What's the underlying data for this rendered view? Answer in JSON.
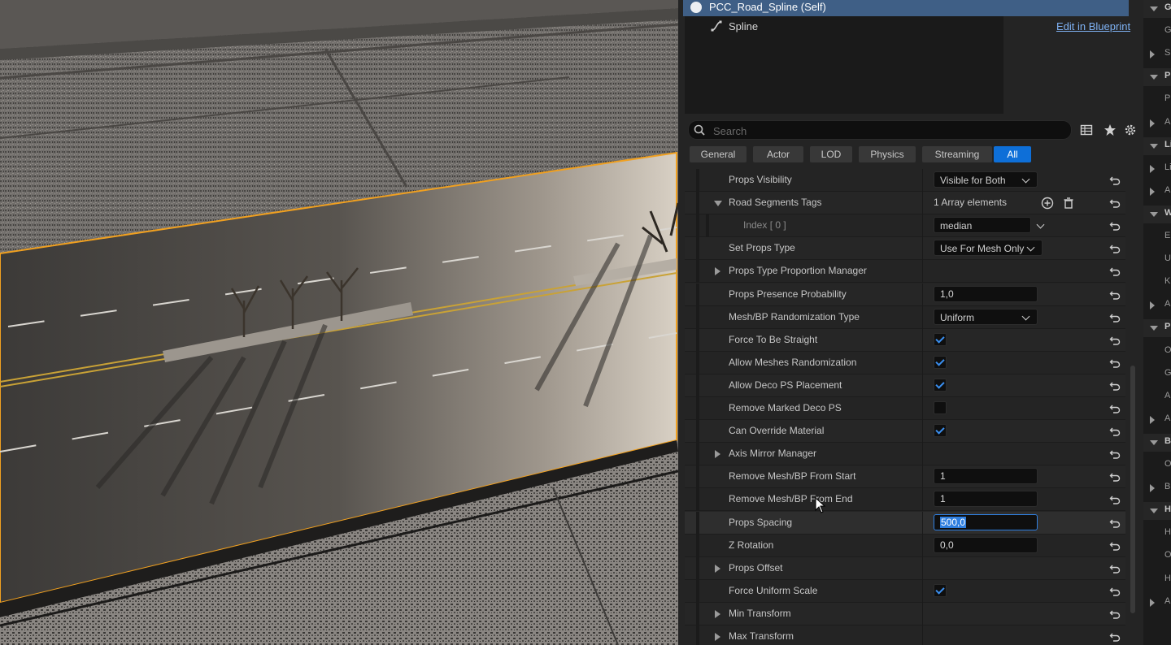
{
  "component_tree": {
    "self_label": "PCC_Road_Spline (Self)",
    "child_label": "Spline",
    "edit_link": "Edit in Blueprint"
  },
  "search": {
    "placeholder": "Search"
  },
  "filter_tabs": [
    "General",
    "Actor",
    "LOD",
    "Physics",
    "Streaming",
    "All"
  ],
  "active_tab": "All",
  "properties": [
    {
      "label": "Props Visibility",
      "type": "dropdown",
      "value": "Visible for Both"
    },
    {
      "label": "Road Segments Tags",
      "type": "array",
      "value": "1 Array elements",
      "expander": "down"
    },
    {
      "label": "Index [ 0 ]",
      "type": "dropdown",
      "value": "median",
      "nested": true
    },
    {
      "label": "Set Props Type",
      "type": "dropdown",
      "value": "Use For Mesh Only"
    },
    {
      "label": "Props Type Proportion Manager",
      "type": "group",
      "expander": "right"
    },
    {
      "label": "Props Presence Probability",
      "type": "number",
      "value": "1,0"
    },
    {
      "label": "Mesh/BP Randomization Type",
      "type": "dropdown",
      "value": "Uniform"
    },
    {
      "label": "Force To Be Straight",
      "type": "checkbox",
      "checked": true
    },
    {
      "label": "Allow Meshes Randomization",
      "type": "checkbox",
      "checked": true
    },
    {
      "label": "Allow Deco PS Placement",
      "type": "checkbox",
      "checked": true
    },
    {
      "label": "Remove Marked Deco PS",
      "type": "checkbox",
      "checked": false
    },
    {
      "label": "Can Override Material",
      "type": "checkbox",
      "checked": true
    },
    {
      "label": "Axis Mirror Manager",
      "type": "group",
      "expander": "right"
    },
    {
      "label": "Remove Mesh/BP From Start",
      "type": "number",
      "value": "1"
    },
    {
      "label": "Remove Mesh/BP From End",
      "type": "number",
      "value": "1"
    },
    {
      "label": "Props Spacing",
      "type": "number",
      "value": "500,0",
      "focused": true
    },
    {
      "label": "Z Rotation",
      "type": "number",
      "value": "0,0"
    },
    {
      "label": "Props Offset",
      "type": "group",
      "expander": "right"
    },
    {
      "label": "Force Uniform Scale",
      "type": "checkbox",
      "checked": true
    },
    {
      "label": "Min Transform",
      "type": "group",
      "expander": "right"
    },
    {
      "label": "Max Transform",
      "type": "group",
      "expander": "right"
    }
  ],
  "right_edge": [
    {
      "kind": "header",
      "text": "G"
    },
    {
      "kind": "item",
      "text": "G"
    },
    {
      "kind": "collapsed",
      "text": "S"
    },
    {
      "kind": "header",
      "text": "P"
    },
    {
      "kind": "item",
      "text": "P"
    },
    {
      "kind": "collapsed",
      "text": "A"
    },
    {
      "kind": "header",
      "text": "Li"
    },
    {
      "kind": "collapsed",
      "text": "Li"
    },
    {
      "kind": "collapsed",
      "text": "A"
    },
    {
      "kind": "header",
      "text": "W"
    },
    {
      "kind": "item",
      "text": "E"
    },
    {
      "kind": "item",
      "text": "U"
    },
    {
      "kind": "item",
      "text": "K"
    },
    {
      "kind": "collapsed",
      "text": "A"
    },
    {
      "kind": "header",
      "text": "P"
    },
    {
      "kind": "item",
      "text": "O"
    },
    {
      "kind": "item",
      "text": "G"
    },
    {
      "kind": "item",
      "text": "A"
    },
    {
      "kind": "collapsed",
      "text": "A"
    },
    {
      "kind": "header",
      "text": "B"
    },
    {
      "kind": "item",
      "text": "O"
    },
    {
      "kind": "collapsed",
      "text": "B"
    },
    {
      "kind": "header",
      "text": "H"
    },
    {
      "kind": "item",
      "text": "H"
    },
    {
      "kind": "item",
      "text": "O"
    },
    {
      "kind": "item",
      "text": "H"
    },
    {
      "kind": "collapsed",
      "text": "A"
    }
  ],
  "colors": {
    "selection_outline": "#f0a020",
    "accent_blue": "#0e6fd8",
    "header_blue": "#3f5f86",
    "link": "#7fb2f4",
    "check": "#3a8ff0"
  }
}
